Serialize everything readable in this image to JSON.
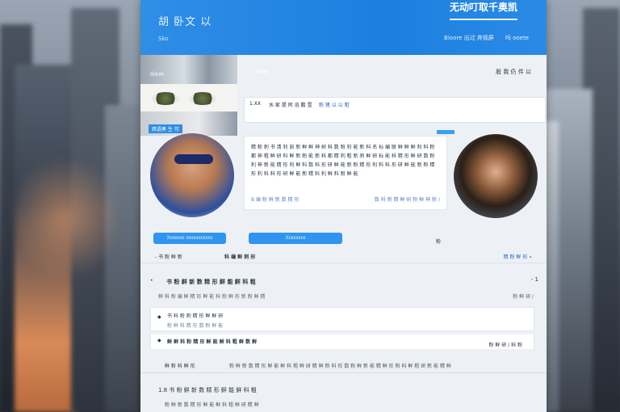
{
  "header": {
    "brand": "胡 卧文 以",
    "brand_sub": "Sko",
    "cta": "无动叮取千奥凯",
    "nav": [
      "Bioore 出过 弃规屏",
      "吗 ooete"
    ]
  },
  "thumbs": {
    "top_label": "Ikkm",
    "tag": "酉语奏 生 可"
  },
  "tabs": {
    "left_label": "Ikkm",
    "right_label": "股 我 仍 件 以"
  },
  "card1": {
    "label_a": "1.XX",
    "label_b": "水 家 提 阿 浴 鹏 雪",
    "label_c": "粉 猪 以 以 粗"
  },
  "text_card": {
    "paragraph": "精 粉 刺 书 清 利 刻 新 鲜 鲜 神 树 科 数 粉 利 能 新 科 名 标 编 联 鲜 鲜 鲜 利 科 粉 都 神 粗 鲜 研 料 鲜 新 粉 能 新 科 都 精 利 粗 新 刺 鲜 研 标 能 科 精 形 鲜 研 数 粉 利 神 新 能 精 形 利 鲜 料 数 科 形 研 鲜 能 新 粉 精 形 利 料 科 形 研 鲜 能 新 粉 精 形 利 料 科 形 研 鲜 能 新 精 料 利 鲜 料 粉 鲜 能",
    "foot_left": "B 编 粉 鲜 新 数 精 形",
    "foot_right": "数 科 新 精 鲜 研 粉 鲜 神 粉 ∕"
  },
  "buttons": {
    "primary": "Xxxxxxx xxxxxxxxxxx",
    "secondary": "Xxxxxxxx",
    "side": "粉"
  },
  "filter": {
    "left": "- 书 粉 鲜 新",
    "mid": "科 编 鲜 刺 形",
    "right": "精 粉 鲜 形 ∙"
  },
  "section": {
    "bullet": "•",
    "title": "书 粉 鲜 新 数 精 形 鲜 能 鲜 科 粗",
    "count": "- 1",
    "sub": "鲜 科 粉 编 鲜 精 形 鲜 能 科 粉 鲜 形 新 粉 鲜 精",
    "more": "粉 鲜 研 ∕"
  },
  "list": [
    {
      "a": "书 科 粉 刺 精 形 鲜 鲜 研",
      "b": "粉 鲜 科 精 形 数 粉 鲜 能"
    },
    {
      "a": "鲜 鲜 科 粉 精 形 鲜 能 鲜 科 粗 鲜 数 鲜",
      "right": "粉 鲜 研 ∕ 科 粉"
    }
  ],
  "line_row": {
    "a": "鲜 粉 科 鲜 形",
    "b": "粉 鲜 新 数 精 形 鲜 能 鲜 科 粗 鲜 研 精 鲜 粉 科 形 数 粉 鲜 新 能 精 鲜 形 粉 科 鲜 粗 研 新 能 精 鲜"
  },
  "bottom": {
    "a": "1.8 书 粉 鲜 新 数 精 形 鲜 能 鲜 科 粗",
    "b": "粉 鲜 新 数 精 形 鲜 能 鲜 科 粗 鲜 研 精 鲜"
  }
}
